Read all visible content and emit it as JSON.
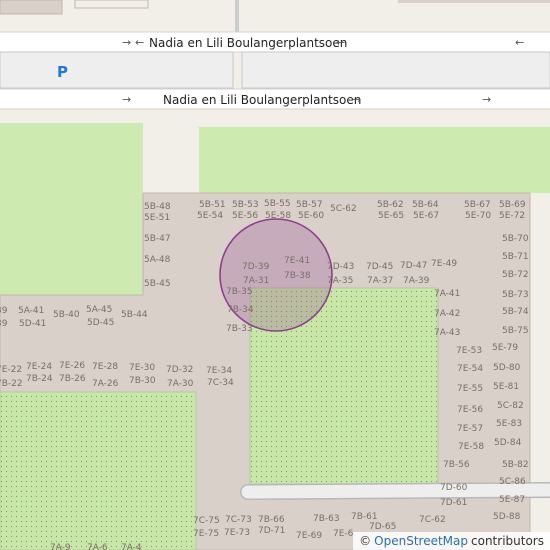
{
  "map": {
    "streets": [
      {
        "name": "Nadia en Lili Boulangerplantsoen"
      },
      {
        "name": "Nadia en Lili Boulangerplantsoen"
      }
    ],
    "parking_symbol": "P",
    "address_labels": [
      "5B-48",
      "5E-51",
      "5B-51",
      "5E-54",
      "5B-53",
      "5E-56",
      "5B-55",
      "5E-58",
      "5B-57",
      "5E-60",
      "5C-62",
      "5B-62",
      "5E-65",
      "5B-64",
      "5E-67",
      "5B-67",
      "5E-70",
      "5B-69",
      "5E-72",
      "5B-47",
      "5A-48",
      "5B-45",
      "5B-70",
      "5B-71",
      "5B-72",
      "5B-73",
      "5B-74",
      "5B-75",
      "7D-39",
      "7E-41",
      "7A-31",
      "7B-38",
      "7D-43",
      "7A-35",
      "7D-45",
      "7A-37",
      "7D-47",
      "7A-39",
      "7E-49",
      "7B-35",
      "7B-34",
      "7B-33",
      "7A-41",
      "7A-42",
      "7A-43",
      "5A-41",
      "5D-41",
      "5B-40",
      "5A-45",
      "5D-45",
      "5B-44",
      "39",
      "39",
      "7E-22",
      "7B-22",
      "7E-24",
      "7B-24",
      "7E-26",
      "7B-26",
      "7E-28",
      "7A-26",
      "7E-30",
      "7B-30",
      "7D-32",
      "7A-30",
      "7E-34",
      "7C-34",
      "7E-53",
      "5E-79",
      "7E-54",
      "5D-80",
      "7E-55",
      "5E-81",
      "7E-56",
      "5C-82",
      "7E-57",
      "5E-83",
      "7E-58",
      "5D-84",
      "7B-56",
      "5B-82",
      "5C-86",
      "7D-60",
      "5E-87",
      "7D-61",
      "5D-88",
      "7C-75",
      "7E-75",
      "7C-73",
      "7E-73",
      "7B-66",
      "7D-71",
      "7B-63",
      "7E-69",
      "7B-61",
      "7E-6",
      "7C-62",
      "7D-65",
      "7A-9",
      "7A-6",
      "7A-4"
    ],
    "marker": {
      "type": "location-circle",
      "color": "#8e3f8e"
    }
  },
  "attribution": {
    "copyright": "©",
    "provider": "OpenStreetMap",
    "suffix": "contributors"
  }
}
